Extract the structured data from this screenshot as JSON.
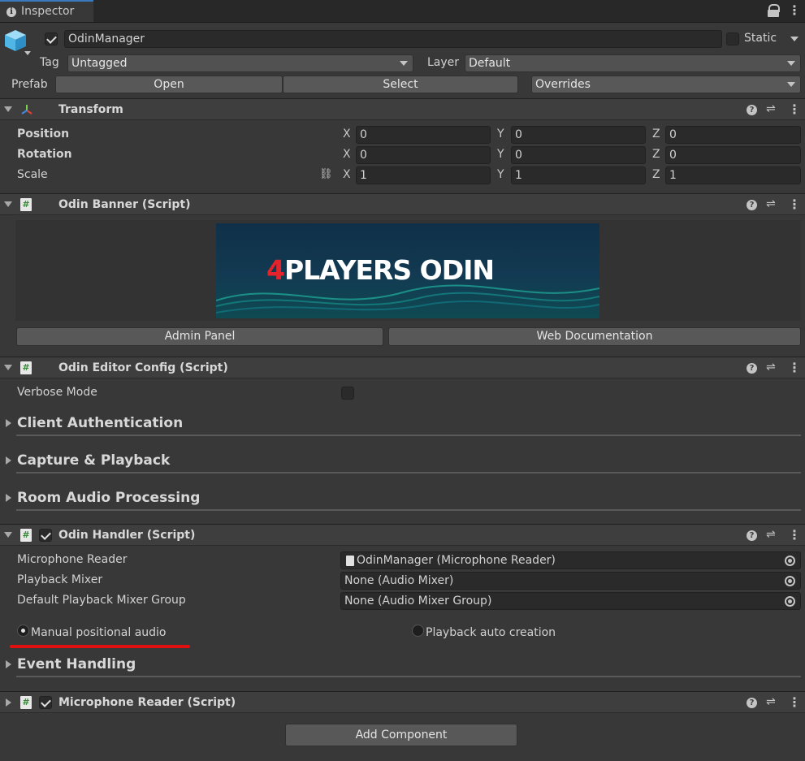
{
  "tab": {
    "title": "Inspector",
    "icon": "info-icon"
  },
  "gameobject": {
    "name": "OdinManager",
    "active": true,
    "static_label": "Static",
    "tag_label": "Tag",
    "tag_value": "Untagged",
    "layer_label": "Layer",
    "layer_value": "Default",
    "prefab_label": "Prefab",
    "prefab_open": "Open",
    "prefab_select": "Select",
    "prefab_overrides": "Overrides"
  },
  "transform": {
    "title": "Transform",
    "rows": [
      {
        "label": "Position",
        "x": "0",
        "y": "0",
        "z": "0"
      },
      {
        "label": "Rotation",
        "x": "0",
        "y": "0",
        "z": "0"
      },
      {
        "label": "Scale",
        "x": "1",
        "y": "1",
        "z": "1"
      }
    ],
    "axis_x": "X",
    "axis_y": "Y",
    "axis_z": "Z"
  },
  "banner": {
    "title": "Odin Banner (Script)",
    "logo_prefix": "4",
    "logo_text": "PLAYERS ODIN",
    "admin_button": "Admin Panel",
    "docs_button": "Web Documentation"
  },
  "editor_config": {
    "title": "Odin Editor Config (Script)",
    "verbose_label": "Verbose Mode",
    "verbose_checked": false,
    "sections": [
      "Client Authentication",
      "Capture & Playback",
      "Room Audio Processing"
    ]
  },
  "handler": {
    "title": "Odin Handler (Script)",
    "enabled": true,
    "fields": [
      {
        "label": "Microphone Reader",
        "value": "OdinManager (Microphone Reader)"
      },
      {
        "label": "Playback Mixer",
        "value": "None (Audio Mixer)"
      },
      {
        "label": "Default Playback Mixer Group",
        "value": "None (Audio Mixer Group)"
      }
    ],
    "radio_manual": "Manual positional audio",
    "radio_auto": "Playback auto creation",
    "event_section": "Event Handling"
  },
  "mic_reader": {
    "title": "Microphone Reader (Script)",
    "enabled": true
  },
  "add_component": "Add Component",
  "colors": {
    "background": "#383838",
    "header": "#3e3e3e",
    "accent": "#3a79bb",
    "highlight_underline": "#e01010",
    "logo_red": "#e5232b"
  }
}
